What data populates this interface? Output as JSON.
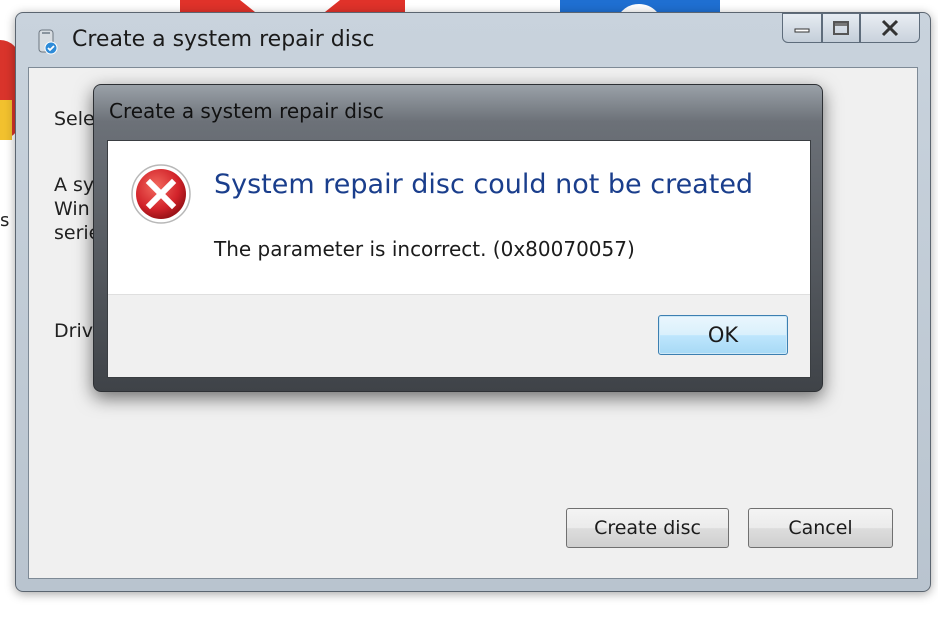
{
  "main_window": {
    "title": "Create a system repair disc",
    "select_text": "Sele",
    "desc_line1": "A sy",
    "desc_line2": "Win",
    "desc_line3": "serie",
    "drive_label": "Driv",
    "create_button": "Create disc",
    "cancel_button": "Cancel",
    "minimize_icon": "minimize-icon",
    "maximize_icon": "maximize-icon",
    "close_icon": "close-icon"
  },
  "dialog": {
    "title": "Create a system repair disc",
    "instruction": "System repair disc could not be created",
    "content": "The parameter is incorrect. (0x80070057)",
    "ok_button": "OK",
    "icon": "error-icon"
  },
  "background": {
    "left_text": "s"
  },
  "colors": {
    "instruction_blue": "#1a3e8c",
    "error_red": "#d2232a",
    "ok_border": "#3c7fb1"
  }
}
